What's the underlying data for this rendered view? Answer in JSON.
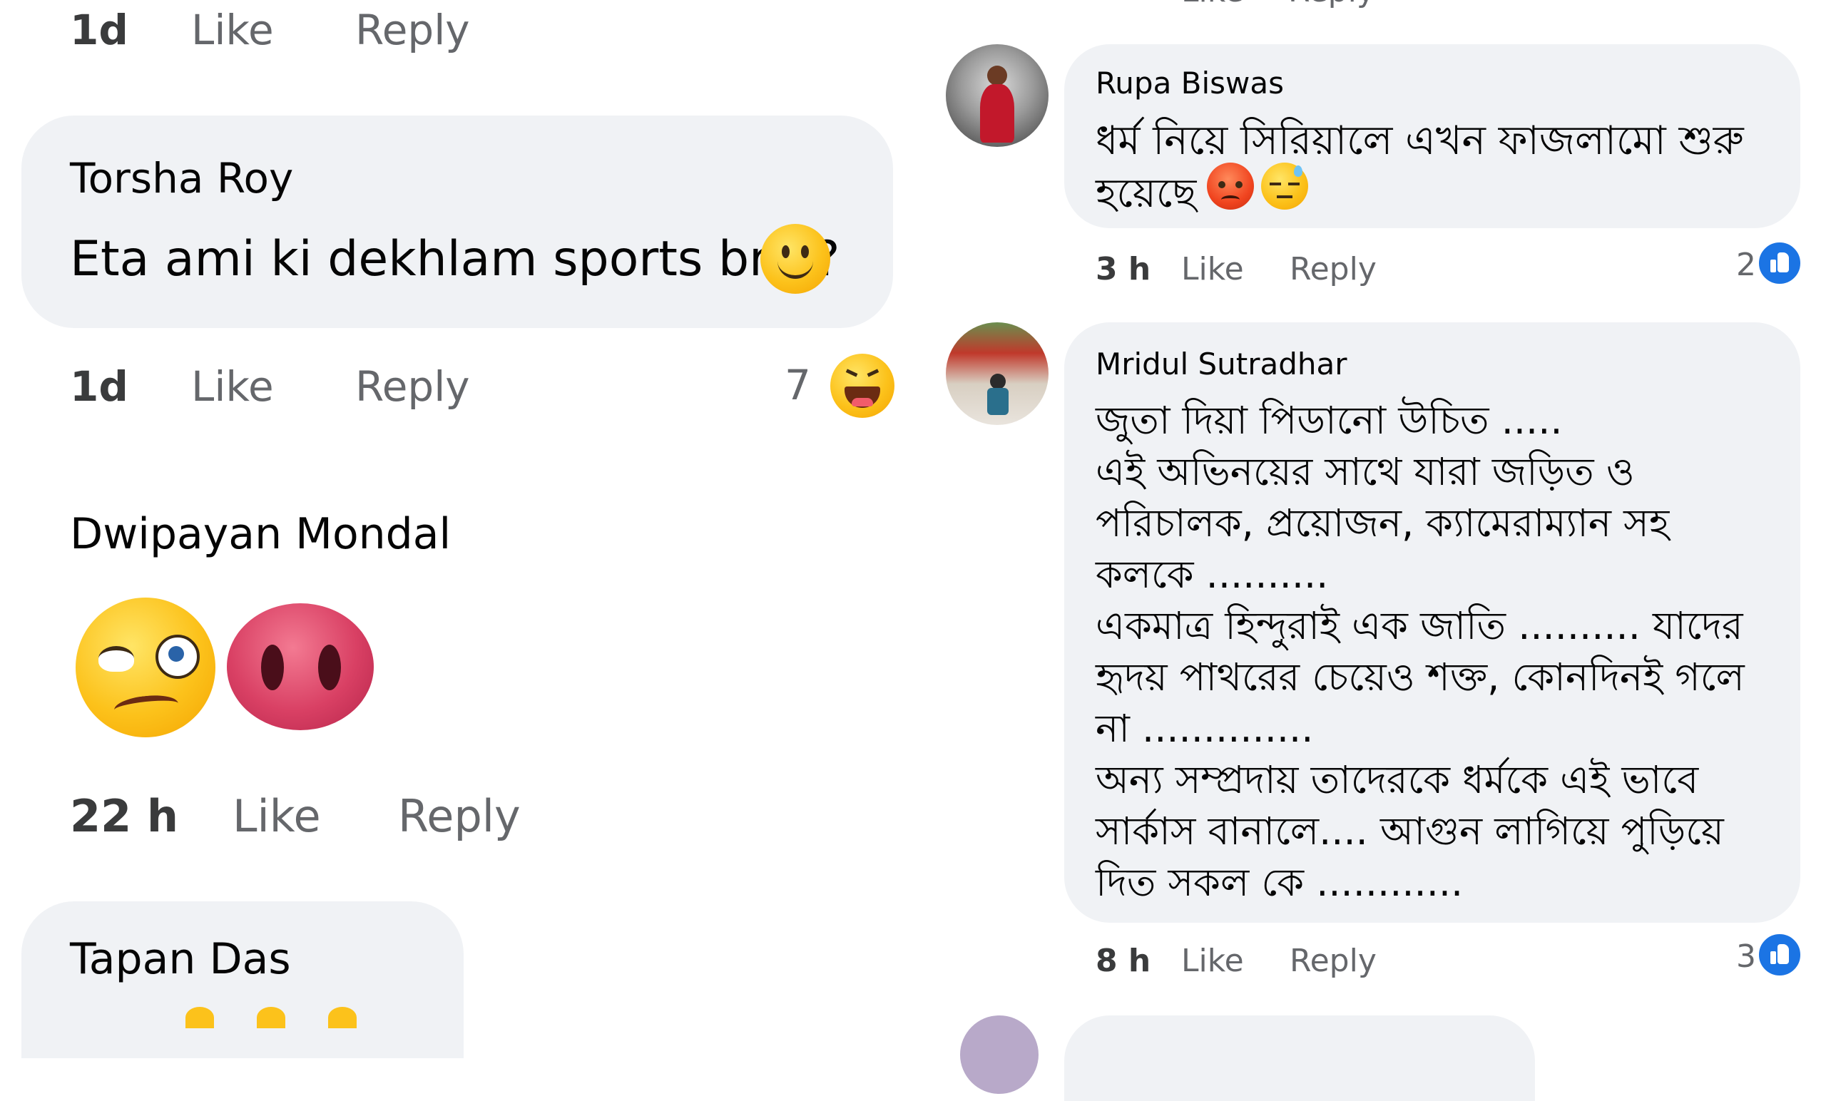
{
  "left": {
    "top_meta": {
      "time": "1d",
      "like": "Like",
      "reply": "Reply"
    },
    "comments": [
      {
        "author": "Torsha Roy",
        "text": "Eta ami ki dekhlam sports bra ?",
        "emoji_in_text": "slightly-smiling-face",
        "time": "1d",
        "like": "Like",
        "reply": "Reply",
        "reaction_count": "7",
        "reaction": "laughing-face"
      },
      {
        "author": "Dwipayan Mondal",
        "emojis": [
          "woozy-face",
          "pig-nose"
        ],
        "time": "22 h",
        "like": "Like",
        "reply": "Reply"
      },
      {
        "author": "Tapan Das"
      }
    ]
  },
  "right": {
    "top_meta": {
      "like": "Like",
      "reply": "Reply"
    },
    "comments": [
      {
        "author": "Rupa Biswas",
        "lines": [
          "ধর্ম নিয়ে সিরিয়ালে এখন ফাজলামো শুরু",
          "হয়েছে"
        ],
        "emojis": [
          "angry-face",
          "sweat-face"
        ],
        "time": "3 h",
        "like": "Like",
        "reply": "Reply",
        "reaction_count": "2",
        "reaction": "like-icon"
      },
      {
        "author": "Mridul Sutradhar",
        "lines": [
          "জুতা দিয়া পিডানো উচিত .....",
          "এই অভিনয়ের সাথে যারা জড়িত ও",
          "পরিচালক, প্রয়োজন, ক্যামেরাম্যান সহ",
          "কলকে ..........",
          "একমাত্র হিন্দুরাই এক জাতি .......... যাদের",
          "হৃদয় পাথরের চেয়েও শক্ত, কোনদিনই গলে",
          "না ..............",
          "অন্য সম্প্রদায় তাদেরকে ধর্মকে এই ভাবে",
          "সার্কাস বানালে.... আগুন লাগিয়ে পুড়িয়ে",
          "দিত সকল কে ............"
        ],
        "time": "8 h",
        "like": "Like",
        "reply": "Reply",
        "reaction_count": "3",
        "reaction": "like-icon"
      }
    ]
  },
  "colors": {
    "bubble": "#f0f2f5",
    "meta_text": "#65676b",
    "like_blue": "#1b74e4"
  }
}
